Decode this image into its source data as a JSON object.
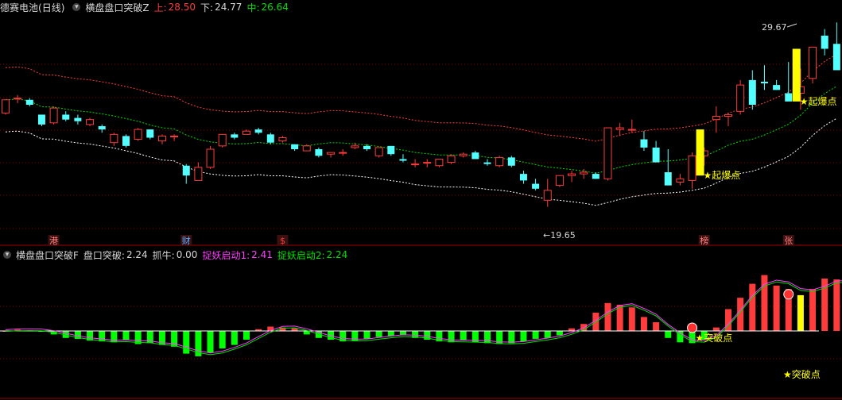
{
  "top_header": {
    "stock_name": "德赛电池",
    "period": "(日线)",
    "indicator": "横盘盘口突破Z",
    "upper_label": "上:",
    "upper_value": "28.50",
    "lower_label": "下:",
    "lower_value": "24.77",
    "mid_label": "中:",
    "mid_value": "26.64"
  },
  "bottom_header": {
    "indicator": "横盘盘口突破F",
    "item1_label": "盘口突破:",
    "item1_value": "2.24",
    "item2_label": "抓牛:",
    "item2_value": "0.00",
    "item3_label": "捉妖启动1:",
    "item3_value": "2.41",
    "item4_label": "捉妖启动2:",
    "item4_value": "2.24"
  },
  "colors": {
    "up": "#ff3c3c",
    "down": "#54ffff",
    "upper_band": "#ff3c3c",
    "mid_band": "#00dd00",
    "lower_band": "#ffffff",
    "signal": "#ffff00",
    "grid": "#8b0000"
  },
  "price_labels": {
    "high": "29.67",
    "low": "19.65"
  },
  "signal_labels": {
    "top_1": "★起爆点",
    "top_2": "★起爆点",
    "bottom_1": "★突破点",
    "bottom_2": "★突破点"
  },
  "markers": [
    {
      "label": "港",
      "candle": 4
    },
    {
      "label": "财",
      "candle": 15
    },
    {
      "label": "$",
      "candle": 23
    },
    {
      "label": "榜",
      "candle": 58
    },
    {
      "label": "张",
      "candle": 65
    }
  ],
  "candles": [
    [
      26.6,
      27.4,
      26.5,
      27.4
    ],
    [
      27.45,
      27.7,
      27.2,
      27.5
    ],
    [
      27.4,
      27.5,
      27.0,
      27.1
    ],
    [
      26.5,
      26.5,
      25.8,
      25.9
    ],
    [
      26.0,
      27.0,
      25.9,
      26.9
    ],
    [
      26.5,
      26.7,
      26.1,
      26.2
    ],
    [
      26.3,
      26.5,
      25.9,
      26.1
    ],
    [
      25.9,
      26.3,
      25.8,
      26.2
    ],
    [
      25.8,
      25.9,
      25.4,
      25.6
    ],
    [
      24.8,
      25.4,
      24.6,
      25.3
    ],
    [
      25.2,
      25.3,
      24.5,
      24.6
    ],
    [
      25.0,
      25.7,
      24.9,
      25.6
    ],
    [
      25.6,
      25.6,
      25.0,
      25.1
    ],
    [
      24.9,
      25.3,
      24.7,
      25.2
    ],
    [
      25.2,
      25.3,
      24.9,
      25.2
    ],
    [
      23.4,
      23.5,
      22.3,
      22.8
    ],
    [
      22.5,
      23.6,
      22.5,
      23.3
    ],
    [
      23.3,
      24.6,
      23.2,
      24.4
    ],
    [
      24.6,
      25.2,
      24.5,
      25.3
    ],
    [
      25.3,
      25.4,
      25.0,
      25.1
    ],
    [
      25.3,
      25.6,
      25.4,
      25.5
    ],
    [
      25.6,
      25.7,
      25.3,
      25.4
    ],
    [
      25.3,
      25.4,
      24.7,
      24.8
    ],
    [
      24.9,
      25.2,
      24.8,
      25.1
    ],
    [
      24.7,
      24.7,
      24.3,
      24.4
    ],
    [
      24.3,
      24.7,
      24.3,
      24.6
    ],
    [
      24.4,
      24.5,
      23.9,
      24.0
    ],
    [
      24.1,
      24.2,
      23.9,
      24.2
    ],
    [
      24.2,
      24.4,
      24.0,
      24.2
    ],
    [
      24.5,
      24.8,
      24.4,
      24.6
    ],
    [
      24.6,
      24.7,
      24.3,
      24.4
    ],
    [
      24.0,
      24.4,
      23.9,
      24.5
    ],
    [
      24.6,
      24.6,
      24.0,
      24.1
    ],
    [
      23.8,
      24.1,
      23.6,
      23.7
    ],
    [
      23.5,
      23.8,
      23.3,
      23.5
    ],
    [
      23.6,
      23.8,
      23.3,
      23.6
    ],
    [
      23.4,
      23.8,
      23.3,
      23.8
    ],
    [
      23.6,
      24.1,
      23.5,
      24.0
    ],
    [
      24.0,
      24.2,
      23.9,
      24.1
    ],
    [
      24.2,
      24.3,
      23.9,
      23.8
    ],
    [
      23.6,
      23.8,
      23.4,
      23.5
    ],
    [
      23.4,
      24.0,
      23.3,
      23.9
    ],
    [
      23.9,
      24.0,
      23.3,
      23.4
    ],
    [
      22.9,
      23.1,
      22.3,
      22.5
    ],
    [
      22.3,
      22.6,
      21.9,
      22.0
    ],
    [
      21.3,
      22.6,
      20.9,
      21.9
    ],
    [
      22.2,
      22.8,
      22.1,
      22.8
    ],
    [
      22.8,
      23.1,
      22.4,
      22.9
    ],
    [
      22.9,
      23.2,
      22.6,
      23.0
    ],
    [
      22.9,
      23.0,
      22.6,
      22.6
    ],
    [
      22.6,
      25.7,
      22.5,
      25.7
    ],
    [
      25.6,
      26.0,
      25.2,
      25.7
    ],
    [
      25.6,
      26.2,
      25.4,
      25.6
    ],
    [
      25.0,
      25.5,
      24.3,
      24.5
    ],
    [
      24.5,
      24.9,
      23.6,
      23.6
    ],
    [
      23.0,
      24.4,
      22.4,
      22.2
    ],
    [
      22.4,
      22.9,
      22.2,
      22.6
    ],
    [
      22.5,
      24.2,
      22.0,
      24.0
    ],
    [
      24.0,
      24.5,
      23.4,
      24.3
    ],
    [
      26.2,
      27.0,
      25.4,
      26.4
    ],
    [
      26.4,
      26.6,
      25.8,
      26.5
    ],
    [
      26.7,
      28.6,
      26.5,
      28.3
    ],
    [
      28.6,
      29.2,
      26.8,
      27.1
    ],
    [
      28.5,
      29.5,
      28.0,
      28.4
    ],
    [
      28.3,
      28.6,
      28.0,
      28.0
    ],
    [
      27.8,
      29.7,
      27.7,
      27.3
    ],
    [
      27.8,
      29.3,
      26.8,
      28.2
    ],
    [
      28.7,
      30.2,
      28.4,
      30.6
    ],
    [
      31.3,
      31.7,
      30.1,
      30.5
    ],
    [
      30.8,
      32.1,
      29.9,
      29.2
    ]
  ],
  "signals_top": [
    {
      "candle": 57,
      "start": 22.8,
      "end": 25.6,
      "text_key": "top_1"
    },
    {
      "candle": 65,
      "start": 27.3,
      "end": 30.5,
      "text_key": "top_2"
    }
  ],
  "oscillator": [
    0.0,
    0.15,
    0.1,
    -0.05,
    -0.4,
    -0.8,
    -0.9,
    -1.1,
    -1.2,
    -1.3,
    -1.0,
    -1.5,
    -1.4,
    -1.6,
    -1.8,
    -2.6,
    -2.9,
    -2.5,
    -2.0,
    -1.6,
    -1.0,
    0.2,
    0.5,
    0.4,
    0.3,
    -0.4,
    -0.8,
    -1.0,
    -1.2,
    -1.1,
    -0.9,
    -0.7,
    -0.6,
    -0.5,
    -0.8,
    -1.0,
    -1.2,
    -1.3,
    -1.1,
    -1.3,
    -1.4,
    -1.5,
    -1.4,
    -1.2,
    -0.9,
    -0.8,
    -0.5,
    0.3,
    0.8,
    2.1,
    3.2,
    3.0,
    2.7,
    1.6,
    1.0,
    -0.8,
    -1.3,
    -1.4,
    -1.0,
    0.4,
    2.5,
    3.8,
    5.4,
    6.4,
    5.2,
    4.8,
    4.1,
    4.8,
    6.0,
    5.9,
    5.0
  ],
  "oscillator_yellow_index": [
    66
  ]
}
